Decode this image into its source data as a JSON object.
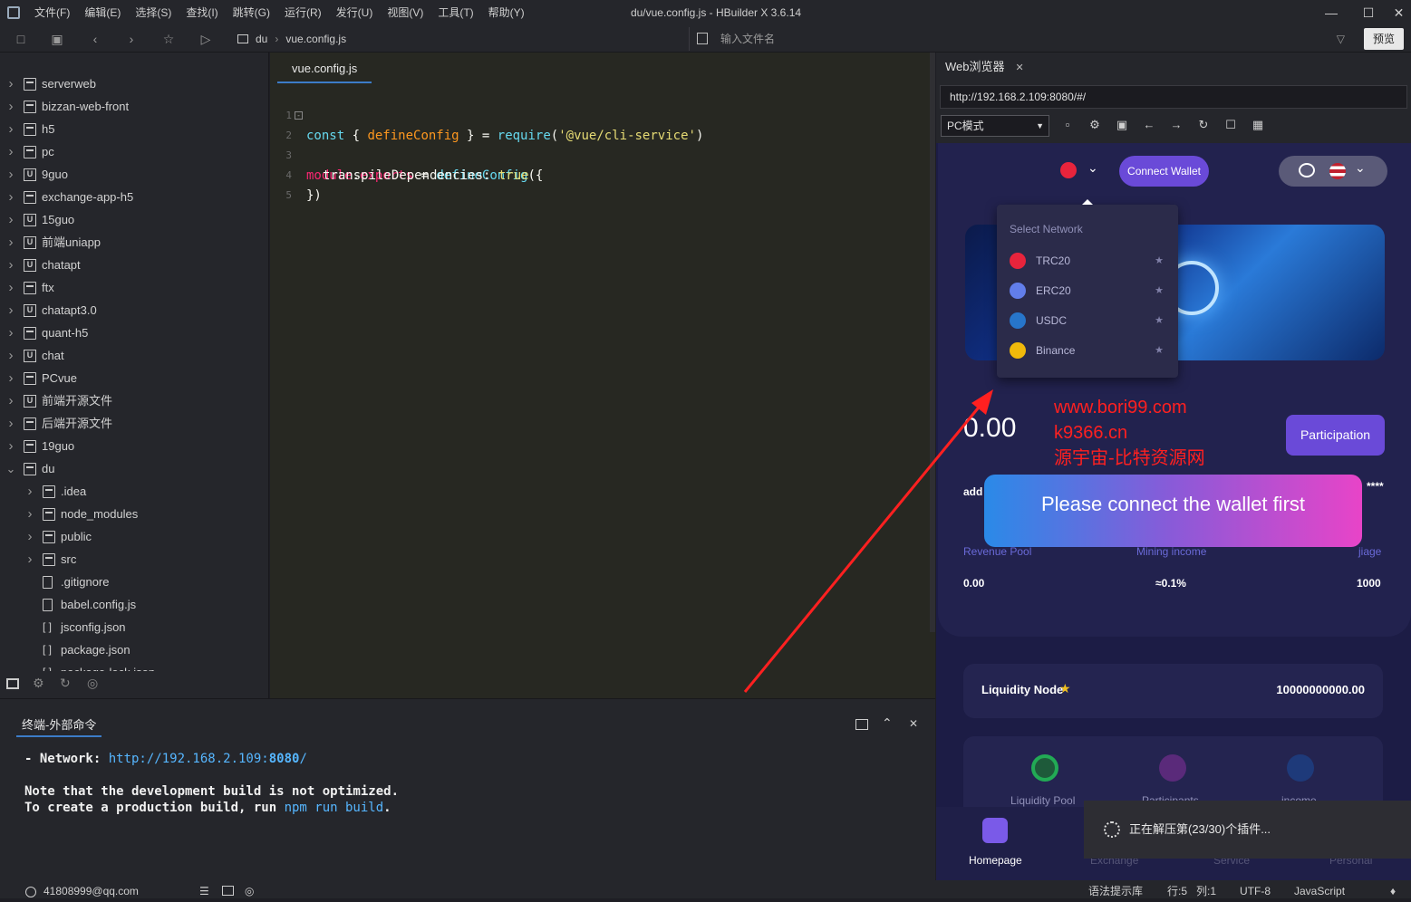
{
  "menu": [
    "文件(F)",
    "编辑(E)",
    "选择(S)",
    "查找(I)",
    "跳转(G)",
    "运行(R)",
    "发行(U)",
    "视图(V)",
    "工具(T)",
    "帮助(Y)"
  ],
  "window_title": "du/vue.config.js - HBuilder X 3.6.14",
  "toolbar": {
    "crumb_root": "du",
    "crumb_file": "vue.config.js",
    "file_input_placeholder": "输入文件名",
    "preview_label": "预览"
  },
  "tree": [
    {
      "label": "serverweb",
      "icon": "folder-icon",
      "depth": 0,
      "expanded": false
    },
    {
      "label": "bizzan-web-front",
      "icon": "folder-icon",
      "depth": 0,
      "expanded": false
    },
    {
      "label": "h5",
      "icon": "folder-icon",
      "depth": 0,
      "expanded": false
    },
    {
      "label": "pc",
      "icon": "folder-icon",
      "depth": 0,
      "expanded": false
    },
    {
      "label": "9guo",
      "icon": "uniapp-icon",
      "depth": 0,
      "expanded": false
    },
    {
      "label": "exchange-app-h5",
      "icon": "folder-icon",
      "depth": 0,
      "expanded": false
    },
    {
      "label": "15guo",
      "icon": "uniapp-icon",
      "depth": 0,
      "expanded": false
    },
    {
      "label": "前端uniapp",
      "icon": "uniapp-icon",
      "depth": 0,
      "expanded": false
    },
    {
      "label": "chatapt",
      "icon": "uniapp-icon",
      "depth": 0,
      "expanded": false
    },
    {
      "label": "ftx",
      "icon": "folder-icon",
      "depth": 0,
      "expanded": false
    },
    {
      "label": "chatapt3.0",
      "icon": "uniapp-icon",
      "depth": 0,
      "expanded": false
    },
    {
      "label": "quant-h5",
      "icon": "folder-icon",
      "depth": 0,
      "expanded": false
    },
    {
      "label": "chat",
      "icon": "uniapp-icon",
      "depth": 0,
      "expanded": false
    },
    {
      "label": "PCvue",
      "icon": "folder-icon",
      "depth": 0,
      "expanded": false
    },
    {
      "label": "前端开源文件",
      "icon": "uniapp-icon",
      "depth": 0,
      "expanded": false
    },
    {
      "label": "后端开源文件",
      "icon": "folder-icon",
      "depth": 0,
      "expanded": false
    },
    {
      "label": "19guo",
      "icon": "folder-icon",
      "depth": 0,
      "expanded": false
    },
    {
      "label": "du",
      "icon": "folder-icon",
      "depth": 0,
      "expanded": true
    },
    {
      "label": ".idea",
      "icon": "folder-icon",
      "depth": 1,
      "expanded": false
    },
    {
      "label": "node_modules",
      "icon": "folder-icon",
      "depth": 1,
      "expanded": false
    },
    {
      "label": "public",
      "icon": "folder-icon",
      "depth": 1,
      "expanded": false
    },
    {
      "label": "src",
      "icon": "folder-icon",
      "depth": 1,
      "expanded": false
    },
    {
      "label": ".gitignore",
      "icon": "file-icon",
      "depth": 1,
      "leaf": true
    },
    {
      "label": "babel.config.js",
      "icon": "file-icon",
      "depth": 1,
      "leaf": true
    },
    {
      "label": "jsconfig.json",
      "icon": "json-icon",
      "depth": 1,
      "leaf": true
    },
    {
      "label": "package.json",
      "icon": "json-icon",
      "depth": 1,
      "leaf": true
    },
    {
      "label": "package-lock.json",
      "icon": "json-icon",
      "depth": 1,
      "leaf": true
    }
  ],
  "editor": {
    "tab": "vue.config.js",
    "line_numbers": [
      "1",
      "2",
      "3",
      "4",
      "5"
    ],
    "code": {
      "l1": {
        "kw": "const",
        "a": " { ",
        "fn": "defineConfig",
        "b": " } = ",
        "req": "require",
        "c": "(",
        "str": "'@vue/cli-service'",
        "d": ")"
      },
      "l2": {
        "kw": "module",
        "a": ".",
        "prop": "exports",
        "b": " = ",
        "fn": "defineConfig",
        "c": "({"
      },
      "l3": {
        "prop": "transpileDependencies",
        "a": ": ",
        "bool": "true"
      },
      "l4": {
        "a": "})"
      }
    }
  },
  "terminal": {
    "tab": "终端-外部命令",
    "network_label": "- Network: ",
    "network_url": "http://192.168.2.109:",
    "network_port": "8080",
    "network_slash": "/",
    "note_line": "Note that the development build is not optimized.",
    "build_line_pre": "To create a production build, run ",
    "build_cmd": "npm run build",
    "build_line_post": "."
  },
  "browser": {
    "tab": "Web浏览器",
    "url": "http://192.168.2.109:8080/#/",
    "mode": "PC模式"
  },
  "webapp": {
    "connect_wallet": "Connect Wallet",
    "dropdown_title": "Select Network",
    "networks": [
      {
        "name": "TRC20",
        "color": "#e8243c"
      },
      {
        "name": "ERC20",
        "color": "#627eea"
      },
      {
        "name": "USDC",
        "color": "#2775ca"
      },
      {
        "name": "Binance",
        "color": "#f0b90b"
      }
    ],
    "amount": "0.00",
    "participation": "Participation",
    "toast": "Please connect the wallet first",
    "addr_label": "add",
    "addr_masked": "****",
    "stats_labels": [
      "Revenue Pool",
      "Mining income",
      "jiage"
    ],
    "stats_values": [
      "0.00",
      "≈0.1%",
      "1000"
    ],
    "liquidity_node_label": "Liquidity Node",
    "liquidity_node_value": "10000000000.00",
    "icon_labels": [
      "Liquidity Pool",
      "Participants",
      "income"
    ],
    "nav": [
      "Homepage",
      "Exchange",
      "Service",
      "Personal"
    ]
  },
  "loading_text": "正在解压第(23/30)个插件...",
  "watermark": [
    "www.bori99.com",
    "k9366.cn",
    "源宇宙-比特资源网"
  ],
  "status": {
    "user": "41808999@qq.com",
    "hint_lib": "语法提示库",
    "row": "行:5",
    "col": "列:1",
    "encoding": "UTF-8",
    "language": "JavaScript"
  },
  "colors": {
    "accent": "#6a4ad8",
    "arrow": "#ff2020",
    "editor_bg": "#272822"
  }
}
